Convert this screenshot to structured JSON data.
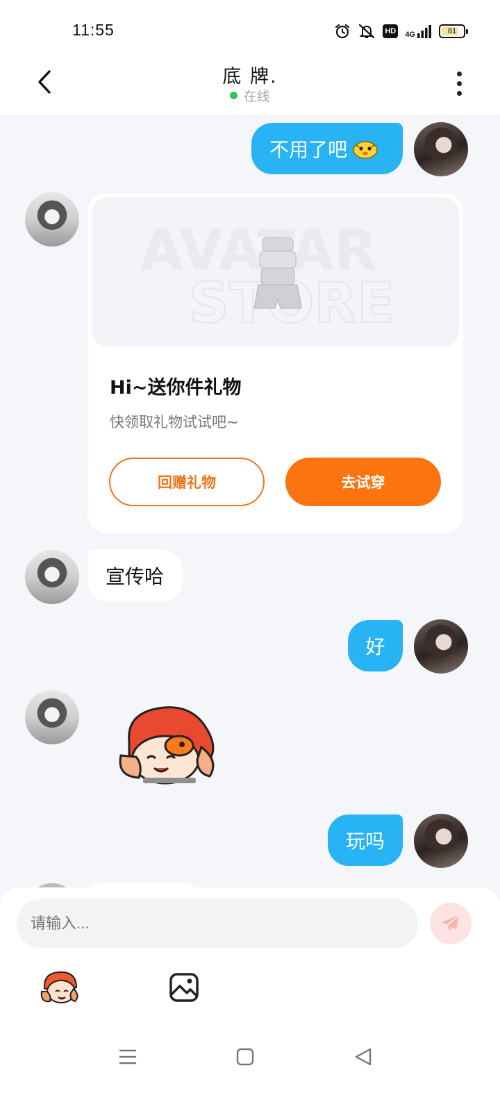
{
  "status_bar": {
    "time": "11:55",
    "hd": "HD",
    "network": "4G",
    "battery": "81",
    "battery_level": 0.81
  },
  "header": {
    "title": "底 牌.",
    "status": "在线"
  },
  "messages": {
    "m1": {
      "text": "不用了吧"
    },
    "gift": {
      "title": "Hi~送你件礼物",
      "subtitle": "快领取礼物试试吧~",
      "return_label": "回赠礼物",
      "try_label": "去试穿",
      "watermark_line1": "AVATAR",
      "watermark_line2": "STORE"
    },
    "m3": {
      "text": "宣传哈"
    },
    "m4": {
      "text": "好"
    },
    "m6": {
      "text": "玩吗"
    }
  },
  "input": {
    "placeholder": "请输入..."
  },
  "colors": {
    "my_bubble": "#28b3f5",
    "accent_orange": "#fb7410",
    "online_green": "#2ec75b"
  },
  "icons": {
    "back": "chevron-left-icon",
    "more": "more-vertical-icon",
    "send": "paper-plane-icon",
    "sticker": "sticker-icon",
    "image": "image-icon"
  }
}
